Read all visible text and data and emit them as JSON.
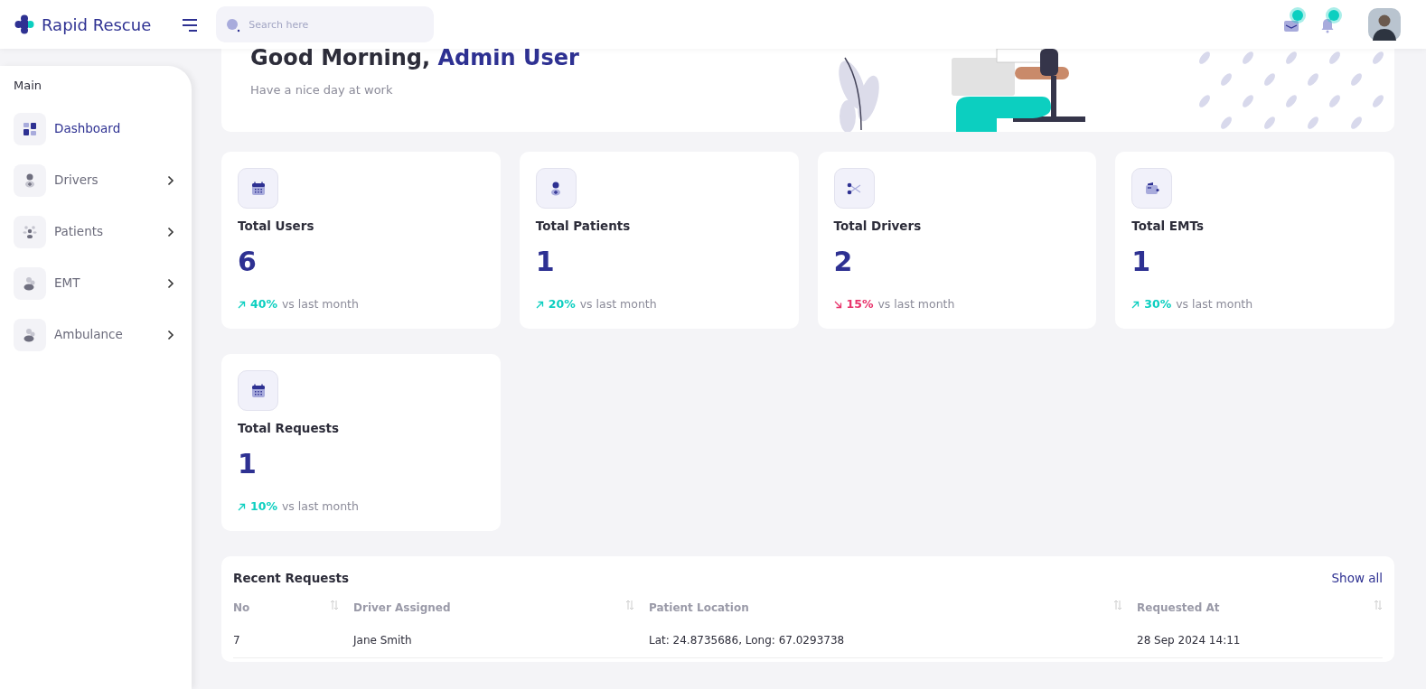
{
  "brand": {
    "name": "Rapid Rescue"
  },
  "search": {
    "placeholder": "Search here"
  },
  "header_icons": [
    {
      "kind": "mail",
      "badge": true
    },
    {
      "kind": "bell",
      "badge": true
    }
  ],
  "sidebar": {
    "section": "Main",
    "items": [
      {
        "label": "Dashboard",
        "kind": "grid",
        "selected": true,
        "expandable": false
      },
      {
        "label": "Drivers",
        "kind": "person",
        "selected": false,
        "expandable": true
      },
      {
        "label": "Patients",
        "kind": "group",
        "selected": false,
        "expandable": true
      },
      {
        "label": "EMT",
        "kind": "people",
        "selected": false,
        "expandable": true
      },
      {
        "label": "Ambulance",
        "kind": "people",
        "selected": false,
        "expandable": true
      }
    ]
  },
  "welcome": {
    "greeting": "Good Morning,",
    "name": "Admin User",
    "subtitle": "Have a nice day at work"
  },
  "stats": [
    {
      "kind": "up",
      "title": "Total Users",
      "value": "6",
      "change": "40%",
      "note": "vs last month"
    },
    {
      "kind": "up",
      "title": "Total Patients",
      "value": "1",
      "change": "20%",
      "note": "vs last month"
    },
    {
      "kind": "down",
      "title": "Total Drivers",
      "value": "2",
      "change": "15%",
      "note": "vs last month"
    },
    {
      "kind": "up",
      "title": "Total EMTs",
      "value": "1",
      "change": "30%",
      "note": "vs last month"
    },
    {
      "kind": "up",
      "title": "Total Requests",
      "value": "1",
      "change": "10%",
      "note": "vs last month"
    }
  ],
  "recent_requests": {
    "title": "Recent Requests",
    "link": "Show all",
    "columns": [
      "No",
      "Driver Assigned",
      "Patient Location",
      "Requested At"
    ],
    "rows": [
      [
        "7",
        "Jane Smith",
        "Lat: 24.8735686, Long: 67.0293738",
        "28 Sep 2024 14:11"
      ]
    ]
  }
}
